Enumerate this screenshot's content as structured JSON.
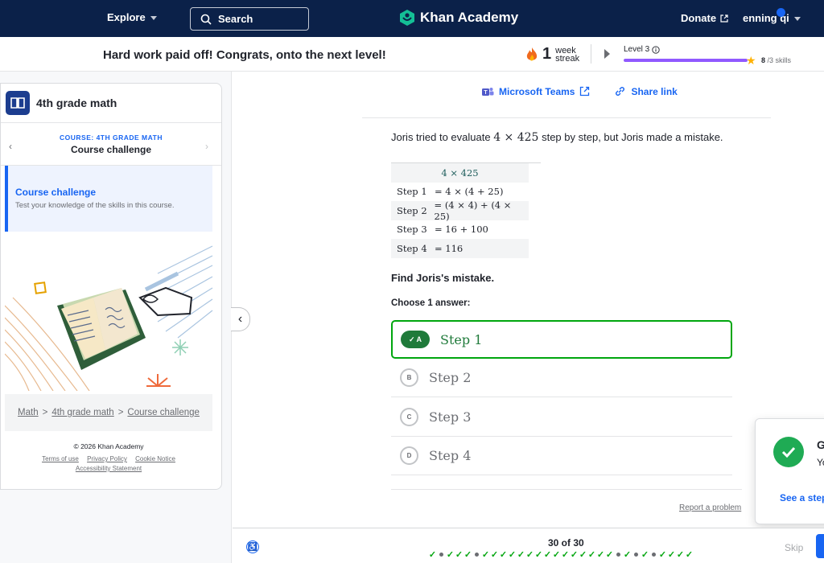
{
  "nav": {
    "explore": "Explore",
    "search_placeholder": "Search",
    "logo": "Khan Academy",
    "donate": "Donate",
    "user": "enning qi"
  },
  "congrats": {
    "message": "Hard work paid off! Congrats, onto the next level!",
    "streak_number": "1",
    "streak_unit": "week",
    "streak_word": "streak",
    "level": "Level 3",
    "level_progress": 1.0,
    "skills_done": "8",
    "skills_total": "/3 skills"
  },
  "sidebar": {
    "title": "4th grade math",
    "course_kicker": "COURSE: 4TH GRADE MATH",
    "course_name": "Course challenge",
    "item_title": "Course challenge",
    "item_desc": "Test your knowledge of the skills in this course.",
    "breadcrumb": [
      "Math",
      "4th grade math",
      "Course challenge"
    ],
    "copyright": "© 2026 Khan Academy",
    "links": [
      "Terms of use",
      "Privacy Policy",
      "Cookie Notice"
    ],
    "accessibility": "Accessibility Statement"
  },
  "share": {
    "teams": "Microsoft Teams",
    "link": "Share link"
  },
  "question": {
    "text_before": "Joris tried to evaluate",
    "expression": "4 × 425",
    "text_after": "step by step, but Joris made a mistake.",
    "steps_header": "4 × 425",
    "steps": [
      {
        "label": "Step 1",
        "expr": "= 4 × (4 + 25)"
      },
      {
        "label": "Step 2",
        "expr": "= (4 × 4) + (4 × 25)"
      },
      {
        "label": "Step 3",
        "expr": "= 16 + 100"
      },
      {
        "label": "Step 4",
        "expr": "= 116"
      }
    ],
    "prompt": "Find Joris's mistake.",
    "choose": "Choose 1 answer:",
    "choices": [
      {
        "letter": "A",
        "text": "Step 1",
        "selected": true
      },
      {
        "letter": "B",
        "text": "Step 2",
        "selected": false
      },
      {
        "letter": "C",
        "text": "Step 3",
        "selected": false
      },
      {
        "letter": "D",
        "text": "Step 4",
        "selected": false
      }
    ],
    "report": "Report a problem"
  },
  "toast": {
    "title": "G",
    "subtitle": "Yo",
    "link": "See a step-"
  },
  "bottom": {
    "progress": "30 of 30",
    "marks": [
      "c",
      "d",
      "c",
      "c",
      "c",
      "d",
      "c",
      "c",
      "c",
      "c",
      "c",
      "c",
      "c",
      "c",
      "c",
      "c",
      "c",
      "c",
      "c",
      "c",
      "c",
      "d",
      "c",
      "d",
      "c",
      "d",
      "c",
      "c",
      "c",
      "c"
    ],
    "skip": "Skip"
  },
  "colors": {
    "nav_bg": "#0b2149",
    "accent_blue": "#1865f2",
    "correct_green": "#00a60e",
    "level_purple": "#9059ff"
  }
}
